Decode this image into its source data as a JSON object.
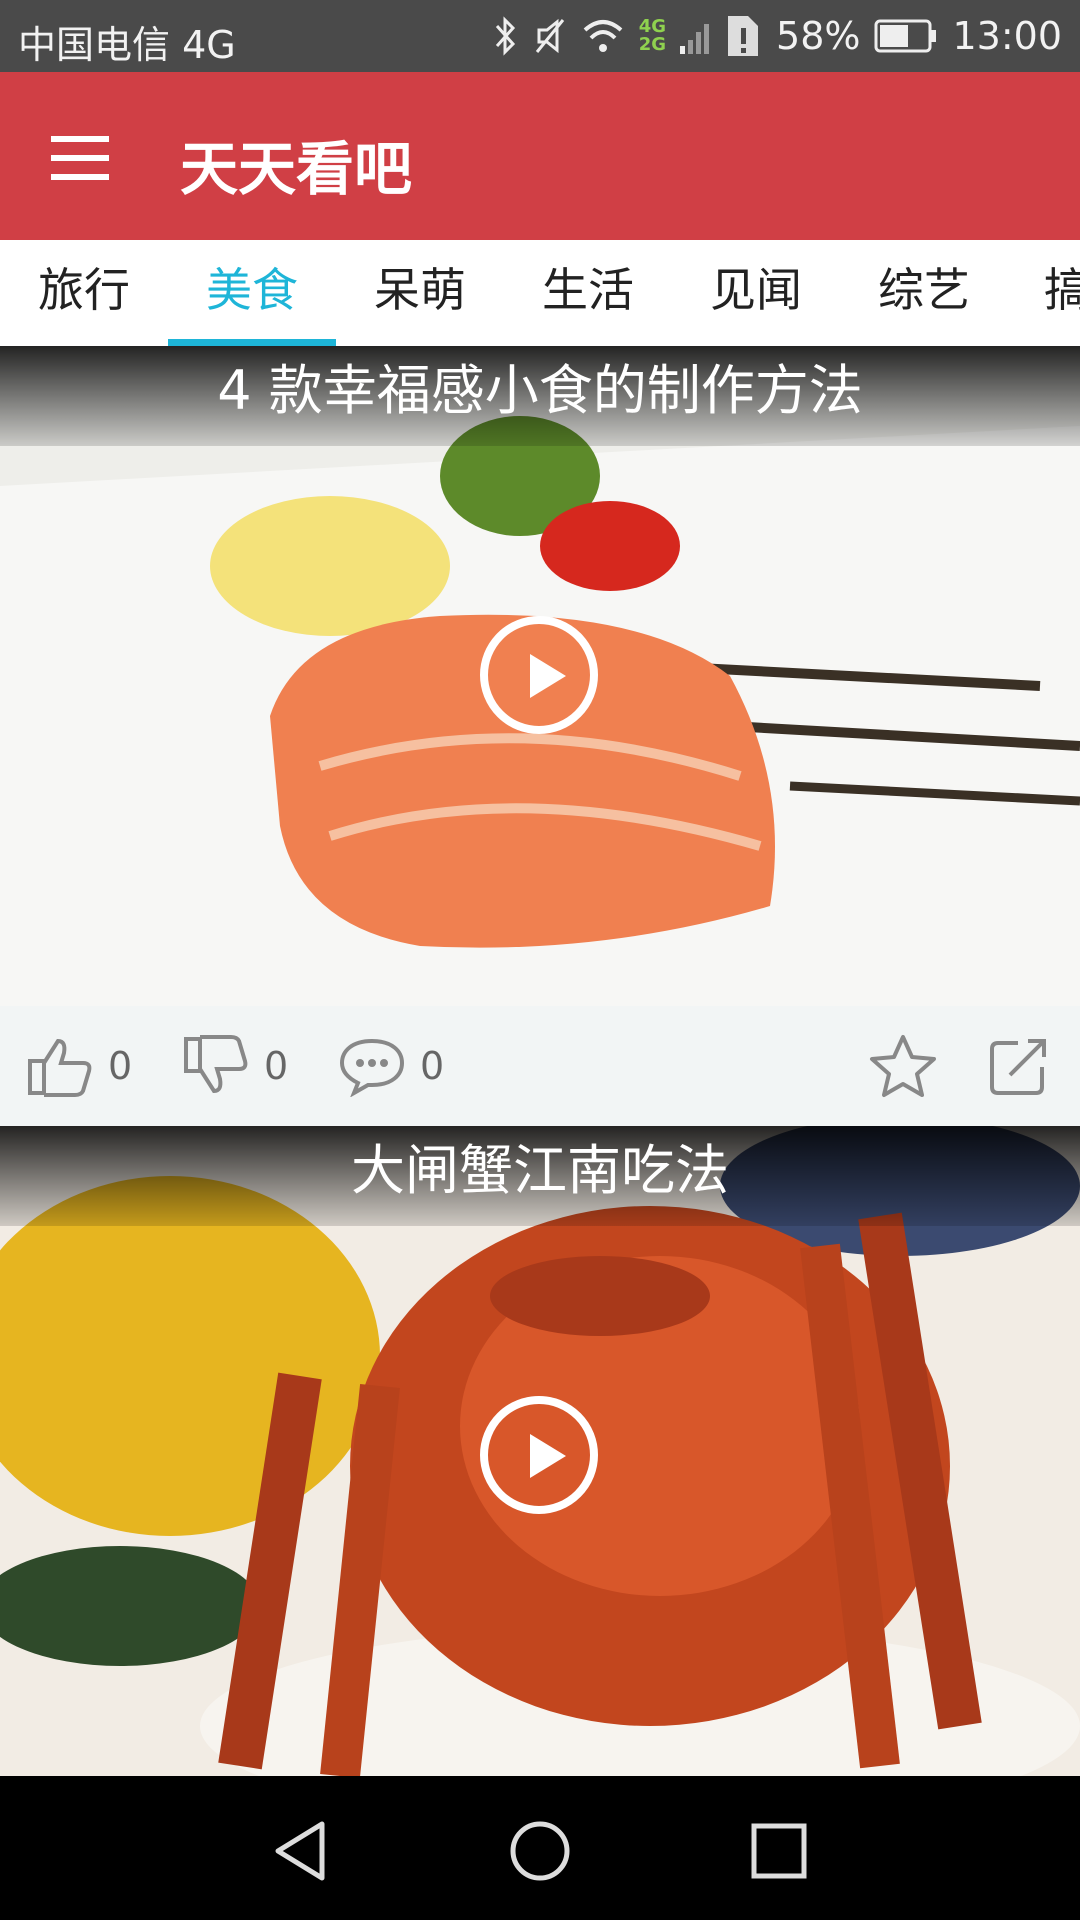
{
  "status_bar": {
    "carrier": "中国电信 4G",
    "network_labels": [
      "4G",
      "2G"
    ],
    "battery": "58%",
    "time": "13:00"
  },
  "app_bar": {
    "title": "天天看吧",
    "menu_icon": "hamburger-menu-icon"
  },
  "tabs": [
    {
      "label": "旅行",
      "active": false
    },
    {
      "label": "美食",
      "active": true
    },
    {
      "label": "呆萌",
      "active": false
    },
    {
      "label": "生活",
      "active": false
    },
    {
      "label": "见闻",
      "active": false
    },
    {
      "label": "综艺",
      "active": false
    },
    {
      "label": "搞",
      "active": false
    }
  ],
  "videos": [
    {
      "title": "4 款幸福感小食的制作方法",
      "thumbnail_desc": "grilled salmon fillet with lemon and tomato slices",
      "likes": "0",
      "dislikes": "0",
      "comments": "0"
    },
    {
      "title": "大闸蟹江南吃法",
      "thumbnail_desc": "steamed hairy crab with chrysanthemum flower"
    }
  ],
  "colors": {
    "app_bar": "#d03f45",
    "tab_active": "#1eb5d8",
    "status_bar": "#4a4a4a",
    "nav_bar": "#000000"
  }
}
